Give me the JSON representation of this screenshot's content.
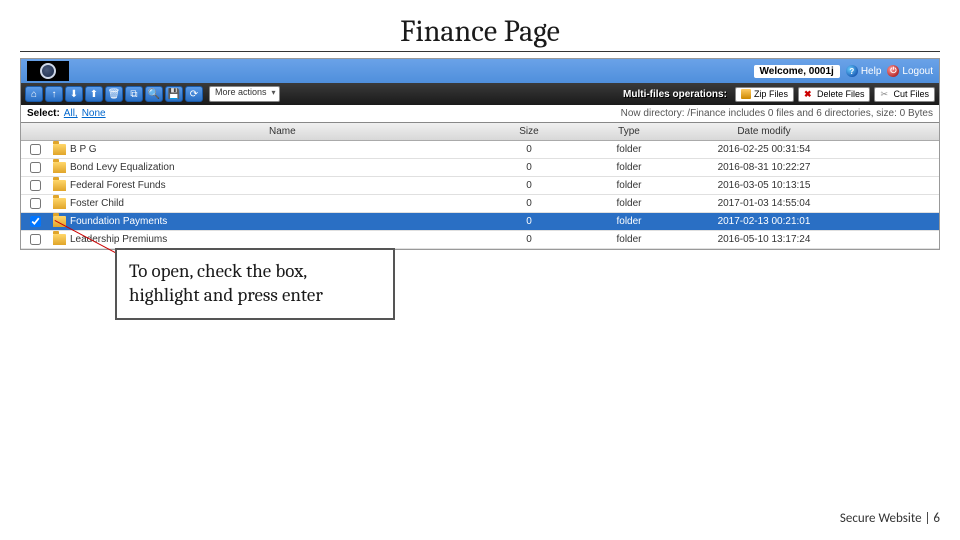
{
  "slide": {
    "title": "Finance Page",
    "callout": "To open, check the box, highlight and press enter",
    "footer": "Secure Website | 6"
  },
  "topbar": {
    "welcome": "Welcome, 0001j",
    "help": "Help",
    "logout": "Logout"
  },
  "toolbar": {
    "more_actions": "More actions",
    "mfo_label": "Multi-files operations:",
    "zip": "Zip Files",
    "delete": "Delete Files",
    "cut": "Cut Files"
  },
  "select_row": {
    "label": "Select:",
    "all": "All,",
    "none": "None",
    "dir_info": "Now directory: /Finance   includes 0 files and 6 directories, size: 0 Bytes"
  },
  "headers": {
    "name": "Name",
    "size": "Size",
    "type": "Type",
    "date": "Date modify"
  },
  "rows": [
    {
      "name": "B P G",
      "size": "0",
      "type": "folder",
      "date": "2016-02-25 00:31:54",
      "selected": false,
      "checked": false
    },
    {
      "name": "Bond Levy Equalization",
      "size": "0",
      "type": "folder",
      "date": "2016-08-31 10:22:27",
      "selected": false,
      "checked": false
    },
    {
      "name": "Federal Forest Funds",
      "size": "0",
      "type": "folder",
      "date": "2016-03-05 10:13:15",
      "selected": false,
      "checked": false
    },
    {
      "name": "Foster Child",
      "size": "0",
      "type": "folder",
      "date": "2017-01-03 14:55:04",
      "selected": false,
      "checked": false
    },
    {
      "name": "Foundation Payments",
      "size": "0",
      "type": "folder",
      "date": "2017-02-13 00:21:01",
      "selected": true,
      "checked": true
    },
    {
      "name": "Leadership Premiums",
      "size": "0",
      "type": "folder",
      "date": "2016-05-10 13:17:24",
      "selected": false,
      "checked": false
    }
  ],
  "toolbar_icons": [
    "home-icon",
    "up-icon",
    "download-icon",
    "upload-icon",
    "delete-icon",
    "copy-icon",
    "search-icon",
    "save-icon",
    "refresh-icon"
  ]
}
